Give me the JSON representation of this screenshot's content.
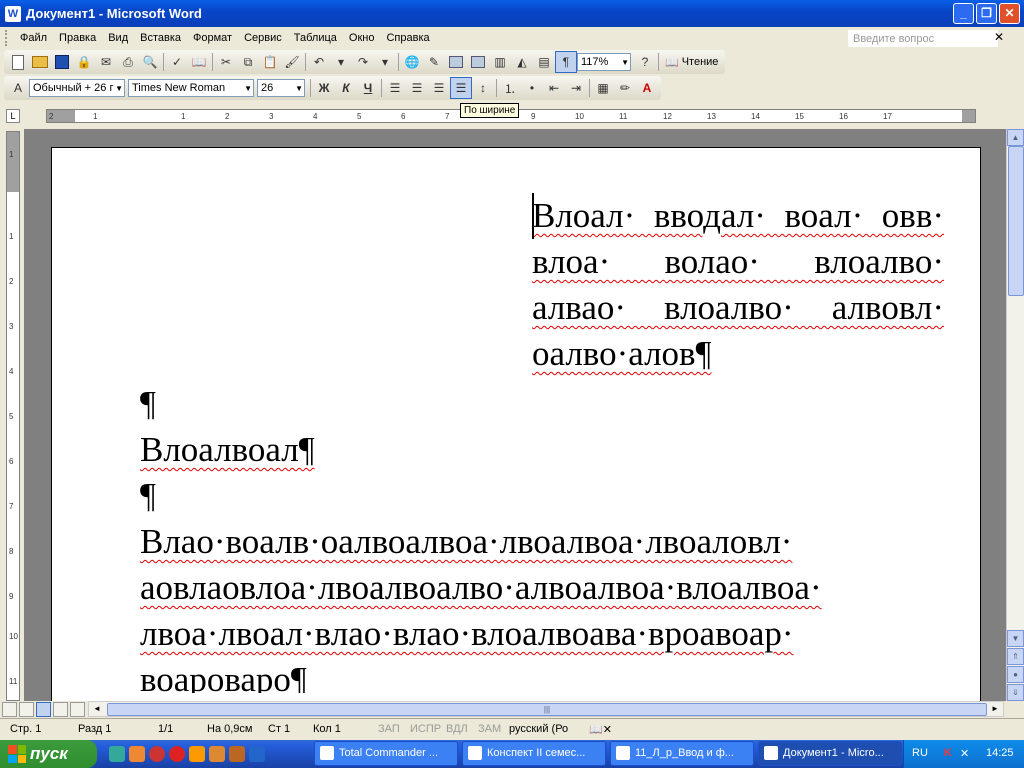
{
  "window": {
    "title": "Документ1 - Microsoft Word"
  },
  "menu": [
    "Файл",
    "Правка",
    "Вид",
    "Вставка",
    "Формат",
    "Сервис",
    "Таблица",
    "Окно",
    "Справка"
  ],
  "question_placeholder": "Введите вопрос",
  "toolbar": {
    "zoom": "117%",
    "read_label": "Чтение"
  },
  "format": {
    "style": "Обычный + 26 г",
    "font": "Times New Roman",
    "size": "26",
    "bold": "Ж",
    "italic": "К",
    "underline": "Ч"
  },
  "tooltip": "По ширине",
  "ruler_h": [
    "2",
    "1",
    "1",
    "2",
    "3",
    "4",
    "5",
    "6",
    "7",
    "8",
    "9",
    "10",
    "11",
    "12",
    "13",
    "14",
    "15",
    "16",
    "17"
  ],
  "ruler_v": [
    "1",
    "1",
    "2",
    "3",
    "4",
    "5",
    "6",
    "7",
    "8",
    "9",
    "10",
    "11"
  ],
  "document": {
    "para1": [
      "Влоал· вводал· воал· овв·",
      "влоа· волао· влоалво·",
      "алвао· влоалво· алвовл·",
      "оалво·алов¶"
    ],
    "pilcrow": "¶",
    "para2": "Влоалвоал¶",
    "para3": [
      "Влао·воалв·оалвоалвоа·лвоалвоа·лвоаловл·",
      "аовлаовлоа·лвоалвоалво·алвоалвоа·влоалвоа·",
      "лвоа·лвоал·влао·влао·влоалвоава·вроавоар·",
      "воароваро¶"
    ]
  },
  "status": {
    "page": "Стр. 1",
    "section": "Разд 1",
    "pages": "1/1",
    "at": "На 0,9см",
    "line": "Ст 1",
    "col": "Кол 1",
    "rec": "ЗАП",
    "trk": "ИСПР",
    "ext": "ВДЛ",
    "ovr": "ЗАМ",
    "lang": "русский (Ро"
  },
  "taskbar": {
    "start": "пуск",
    "tasks": [
      "Total Commander ...",
      "Конспект II семес...",
      "11_Л_р_Ввод и ф...",
      "Документ1 - Micro..."
    ],
    "lang": "RU",
    "time": "14:25"
  }
}
